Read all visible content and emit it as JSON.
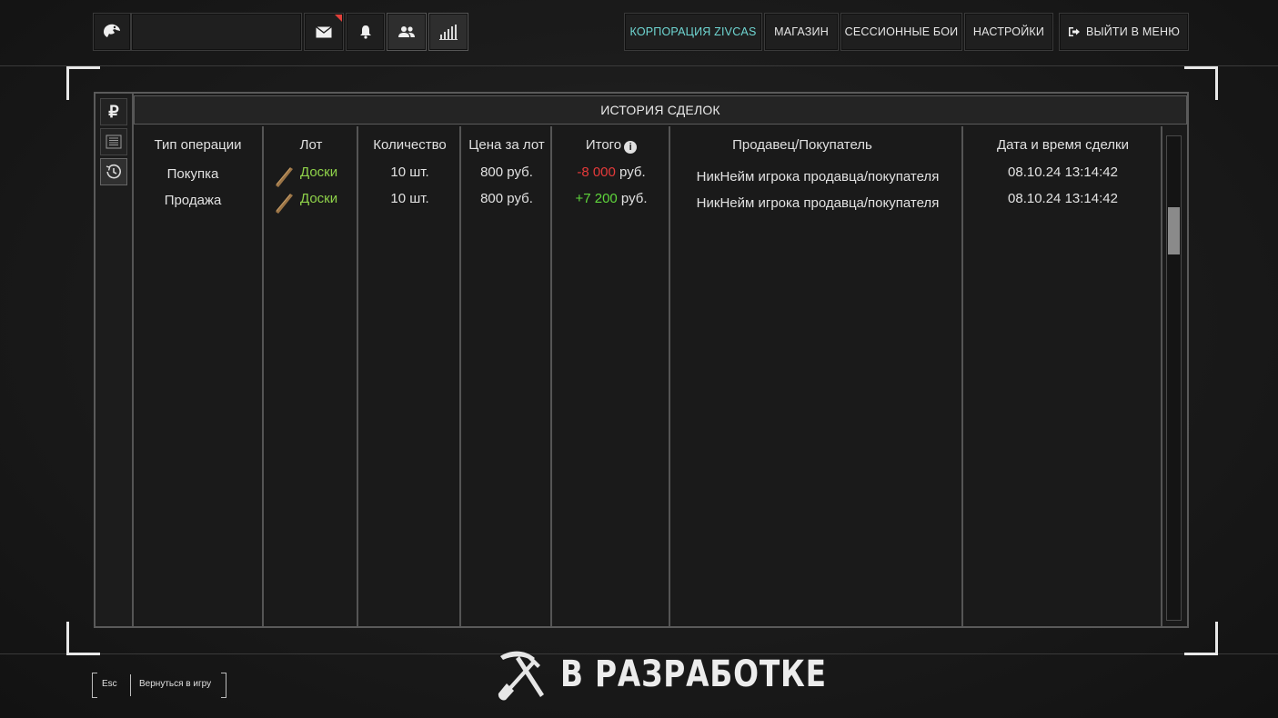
{
  "topbar": {
    "nav": [
      {
        "label": "КОРПОРАЦИЯ ZIVCAS",
        "highlight": true
      },
      {
        "label": "МАГАЗИН"
      },
      {
        "label": "СЕССИОННЫЕ БОИ"
      },
      {
        "label": "НАСТРОЙКИ"
      }
    ],
    "exit_label": "ВЫЙТИ В МЕНЮ"
  },
  "sidebar": {
    "currency_symbol": "₽"
  },
  "panel": {
    "title": "ИСТОРИЯ СДЕЛОК"
  },
  "table": {
    "headers": {
      "type": "Тип операции",
      "lot": "Лот",
      "qty": "Количество",
      "price": "Цена за лот",
      "total": "Итого",
      "party": "Продавец/Покупатель",
      "date": "Дата и время сделки"
    },
    "rows": [
      {
        "type": "Покупка",
        "lot": "Доски",
        "qty": "10 шт.",
        "price": "800 руб.",
        "total_value": "-8 000",
        "total_unit": "руб.",
        "party": "НикНейм игрока продавца/покупателя",
        "date": "08.10.24 13:14:42"
      },
      {
        "type": "Продажа",
        "lot": "Доски",
        "qty": "10 шт.",
        "price": "800 руб.",
        "total_value": "+7 200",
        "total_unit": "руб.",
        "party": "НикНейм игрока продавца/покупателя",
        "date": "08.10.24 13:14:42"
      }
    ]
  },
  "footer": {
    "esc_key": "Esc",
    "back_label": "Вернуться в игру",
    "dev_label": "В РАЗРАБОТКЕ"
  },
  "colors": {
    "accent": "#6fd6d2",
    "negative": "#e53a3a",
    "positive": "#5fd63c",
    "lot_name": "#8fd24a"
  }
}
